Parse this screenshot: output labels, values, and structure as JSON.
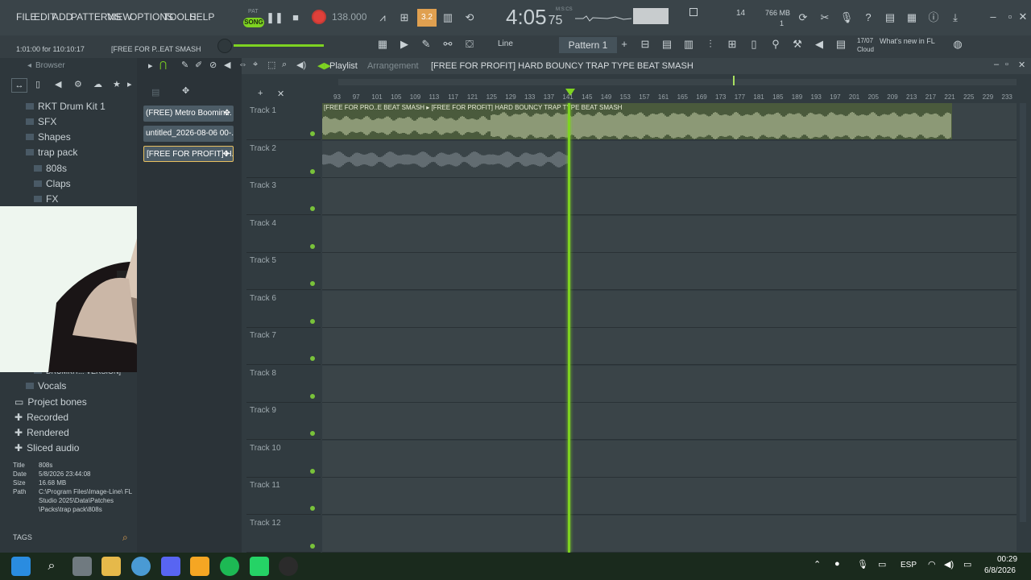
{
  "menu": [
    "FILE",
    "EDIT",
    "ADD",
    "PATTERNS",
    "VIEW",
    "OPTIONS",
    "TOOLS",
    "HELP"
  ],
  "transport": {
    "song_small": "PAT",
    "song_label": "SONG",
    "tempo": "138.000",
    "time": "4:05",
    "time_sub": "75",
    "time_unit": "M:S:CS",
    "cpu": "14",
    "mem": "766 MB",
    "voices": "1"
  },
  "hint_bar": {
    "position": "1:01:00 for 110:10:17",
    "project": "[FREE FOR P..EAT SMASH"
  },
  "toolbar": {
    "snap": "Line",
    "pattern": "Pattern 1",
    "news_date": "17/07",
    "news_text": "What's new in FL",
    "news_sub": "Cloud"
  },
  "browser": {
    "title": "Browser",
    "items": [
      {
        "label": "RKT Drum Kit 1"
      },
      {
        "label": "SFX"
      },
      {
        "label": "Shapes"
      },
      {
        "label": "trap pack"
      },
      {
        "label": "808s"
      },
      {
        "label": "Claps"
      },
      {
        "label": "FX"
      },
      {
        "label": "DRUMKIT... VERSION]"
      },
      {
        "label": "Vocals"
      },
      {
        "label": "Project bones"
      },
      {
        "label": "Recorded"
      },
      {
        "label": "Rendered"
      },
      {
        "label": "Sliced audio"
      }
    ],
    "info": {
      "title_label": "Title",
      "title_val": "808s",
      "date_label": "Date",
      "date_val": "5/8/2026 23:44:08",
      "size_label": "Size",
      "size_val": "16.68 MB",
      "path_label": "Path",
      "path_val": "C:\\Program Files\\Image-Line\\ FL Studio 2025\\Data\\Patches \\Packs\\trap pack\\808s"
    },
    "tags": "TAGS"
  },
  "picker": [
    {
      "label": "(FREE) Metro Boomin..."
    },
    {
      "label": "untitled_2026-08-06 00-..."
    },
    {
      "label": "[FREE FOR PROFIT] H..."
    }
  ],
  "playlist": {
    "title": "Playlist",
    "sub": "Arrangement",
    "project": "[FREE FOR PROFIT] HARD BOUNCY TRAP TYPE BEAT SMASH",
    "clip1_label": "[FREE FOR PRO..E BEAT SMASH ▸ [FREE FOR PROFIT] HARD BOUNCY TRAP TYPE BEAT SMASH",
    "tracks": [
      "Track 1",
      "Track 2",
      "Track 3",
      "Track 4",
      "Track 5",
      "Track 6",
      "Track 7",
      "Track 8",
      "Track 9",
      "Track 10",
      "Track 11",
      "Track 12"
    ],
    "ruler": [
      "93",
      "97",
      "101",
      "105",
      "109",
      "113",
      "117",
      "121",
      "125",
      "129",
      "133",
      "137",
      "141",
      "145",
      "149",
      "153",
      "157",
      "161",
      "165",
      "169",
      "173",
      "177",
      "181",
      "185",
      "189",
      "193",
      "197",
      "201",
      "205",
      "209",
      "213",
      "217",
      "221",
      "225",
      "229",
      "233"
    ]
  },
  "taskbar": {
    "lang": "ESP",
    "time": "00:29",
    "date": "6/8/2026"
  },
  "colors": {
    "accent": "#7ed321",
    "clip": "#4a5a3c",
    "wave": "#cfd8b0",
    "record": "#e0403a"
  }
}
